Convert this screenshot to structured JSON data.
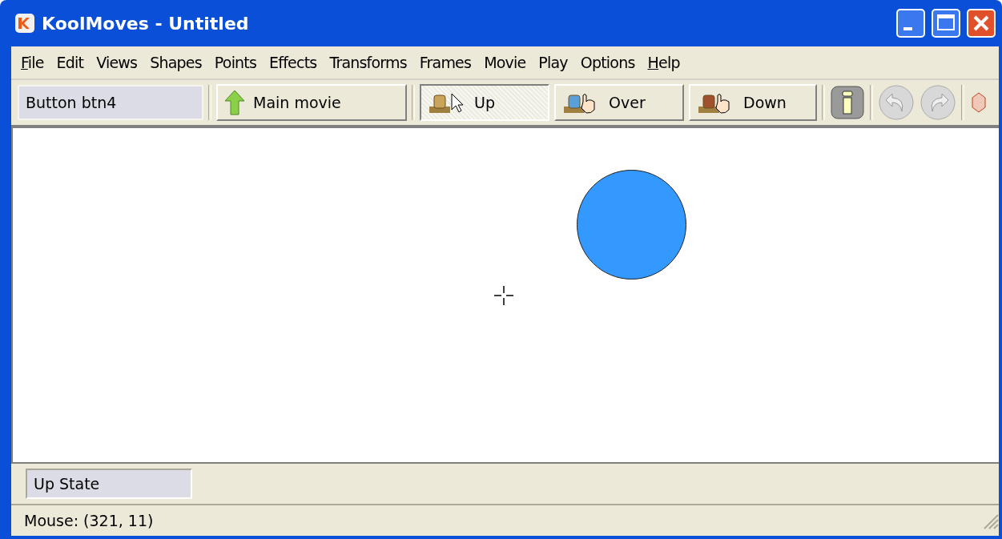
{
  "window": {
    "title": "KoolMoves - Untitled"
  },
  "menu": [
    {
      "label": "File",
      "mnemonic": true
    },
    {
      "label": "Edit",
      "mnemonic": false
    },
    {
      "label": "Views",
      "mnemonic": false
    },
    {
      "label": "Shapes",
      "mnemonic": false
    },
    {
      "label": "Points",
      "mnemonic": false
    },
    {
      "label": "Effects",
      "mnemonic": false
    },
    {
      "label": "Transforms",
      "mnemonic": false
    },
    {
      "label": "Frames",
      "mnemonic": false
    },
    {
      "label": "Movie",
      "mnemonic": false
    },
    {
      "label": "Play",
      "mnemonic": false
    },
    {
      "label": "Options",
      "mnemonic": false
    },
    {
      "label": "Help",
      "mnemonic": true
    }
  ],
  "toolbar": {
    "object_name": "Button btn4",
    "main_movie": "Main movie",
    "states": [
      {
        "label": "Up",
        "kind": "up",
        "selected": true
      },
      {
        "label": "Over",
        "kind": "over",
        "selected": false
      },
      {
        "label": "Down",
        "kind": "down",
        "selected": false
      }
    ]
  },
  "canvas": {
    "shapes": [
      {
        "kind": "circle",
        "color": "#3399ff"
      }
    ]
  },
  "state_bar": {
    "label": "Up State"
  },
  "status_bar": {
    "text": "Mouse: (321, 11)"
  }
}
